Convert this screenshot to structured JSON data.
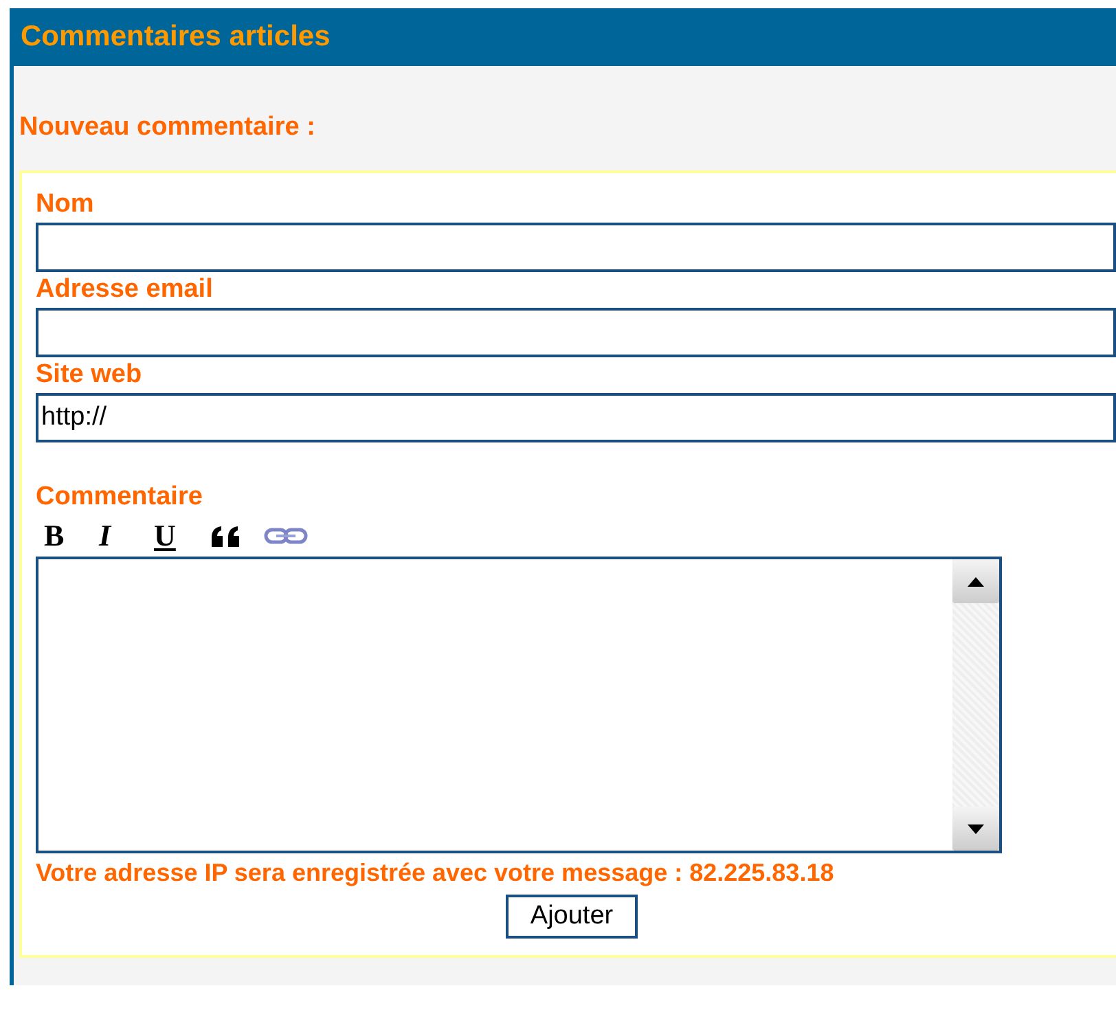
{
  "panel": {
    "title": "Commentaires articles",
    "subtitle": "Nouveau commentaire :"
  },
  "fields": [
    {
      "label": "Nom"
    },
    {
      "label": "Adresse email"
    },
    {
      "label": "Site web",
      "value": "http://"
    }
  ],
  "comment": {
    "label": "Commentaire",
    "toolbar": [
      {
        "kind": "bold",
        "label": "B"
      },
      {
        "kind": "italic",
        "label": "I"
      },
      {
        "kind": "underline",
        "label": "U"
      },
      {
        "kind": "quote"
      },
      {
        "kind": "link"
      }
    ]
  },
  "notice": "Votre adresse IP sera enregistrée avec votre message : 82.225.83.18",
  "submit": "Ajouter"
}
